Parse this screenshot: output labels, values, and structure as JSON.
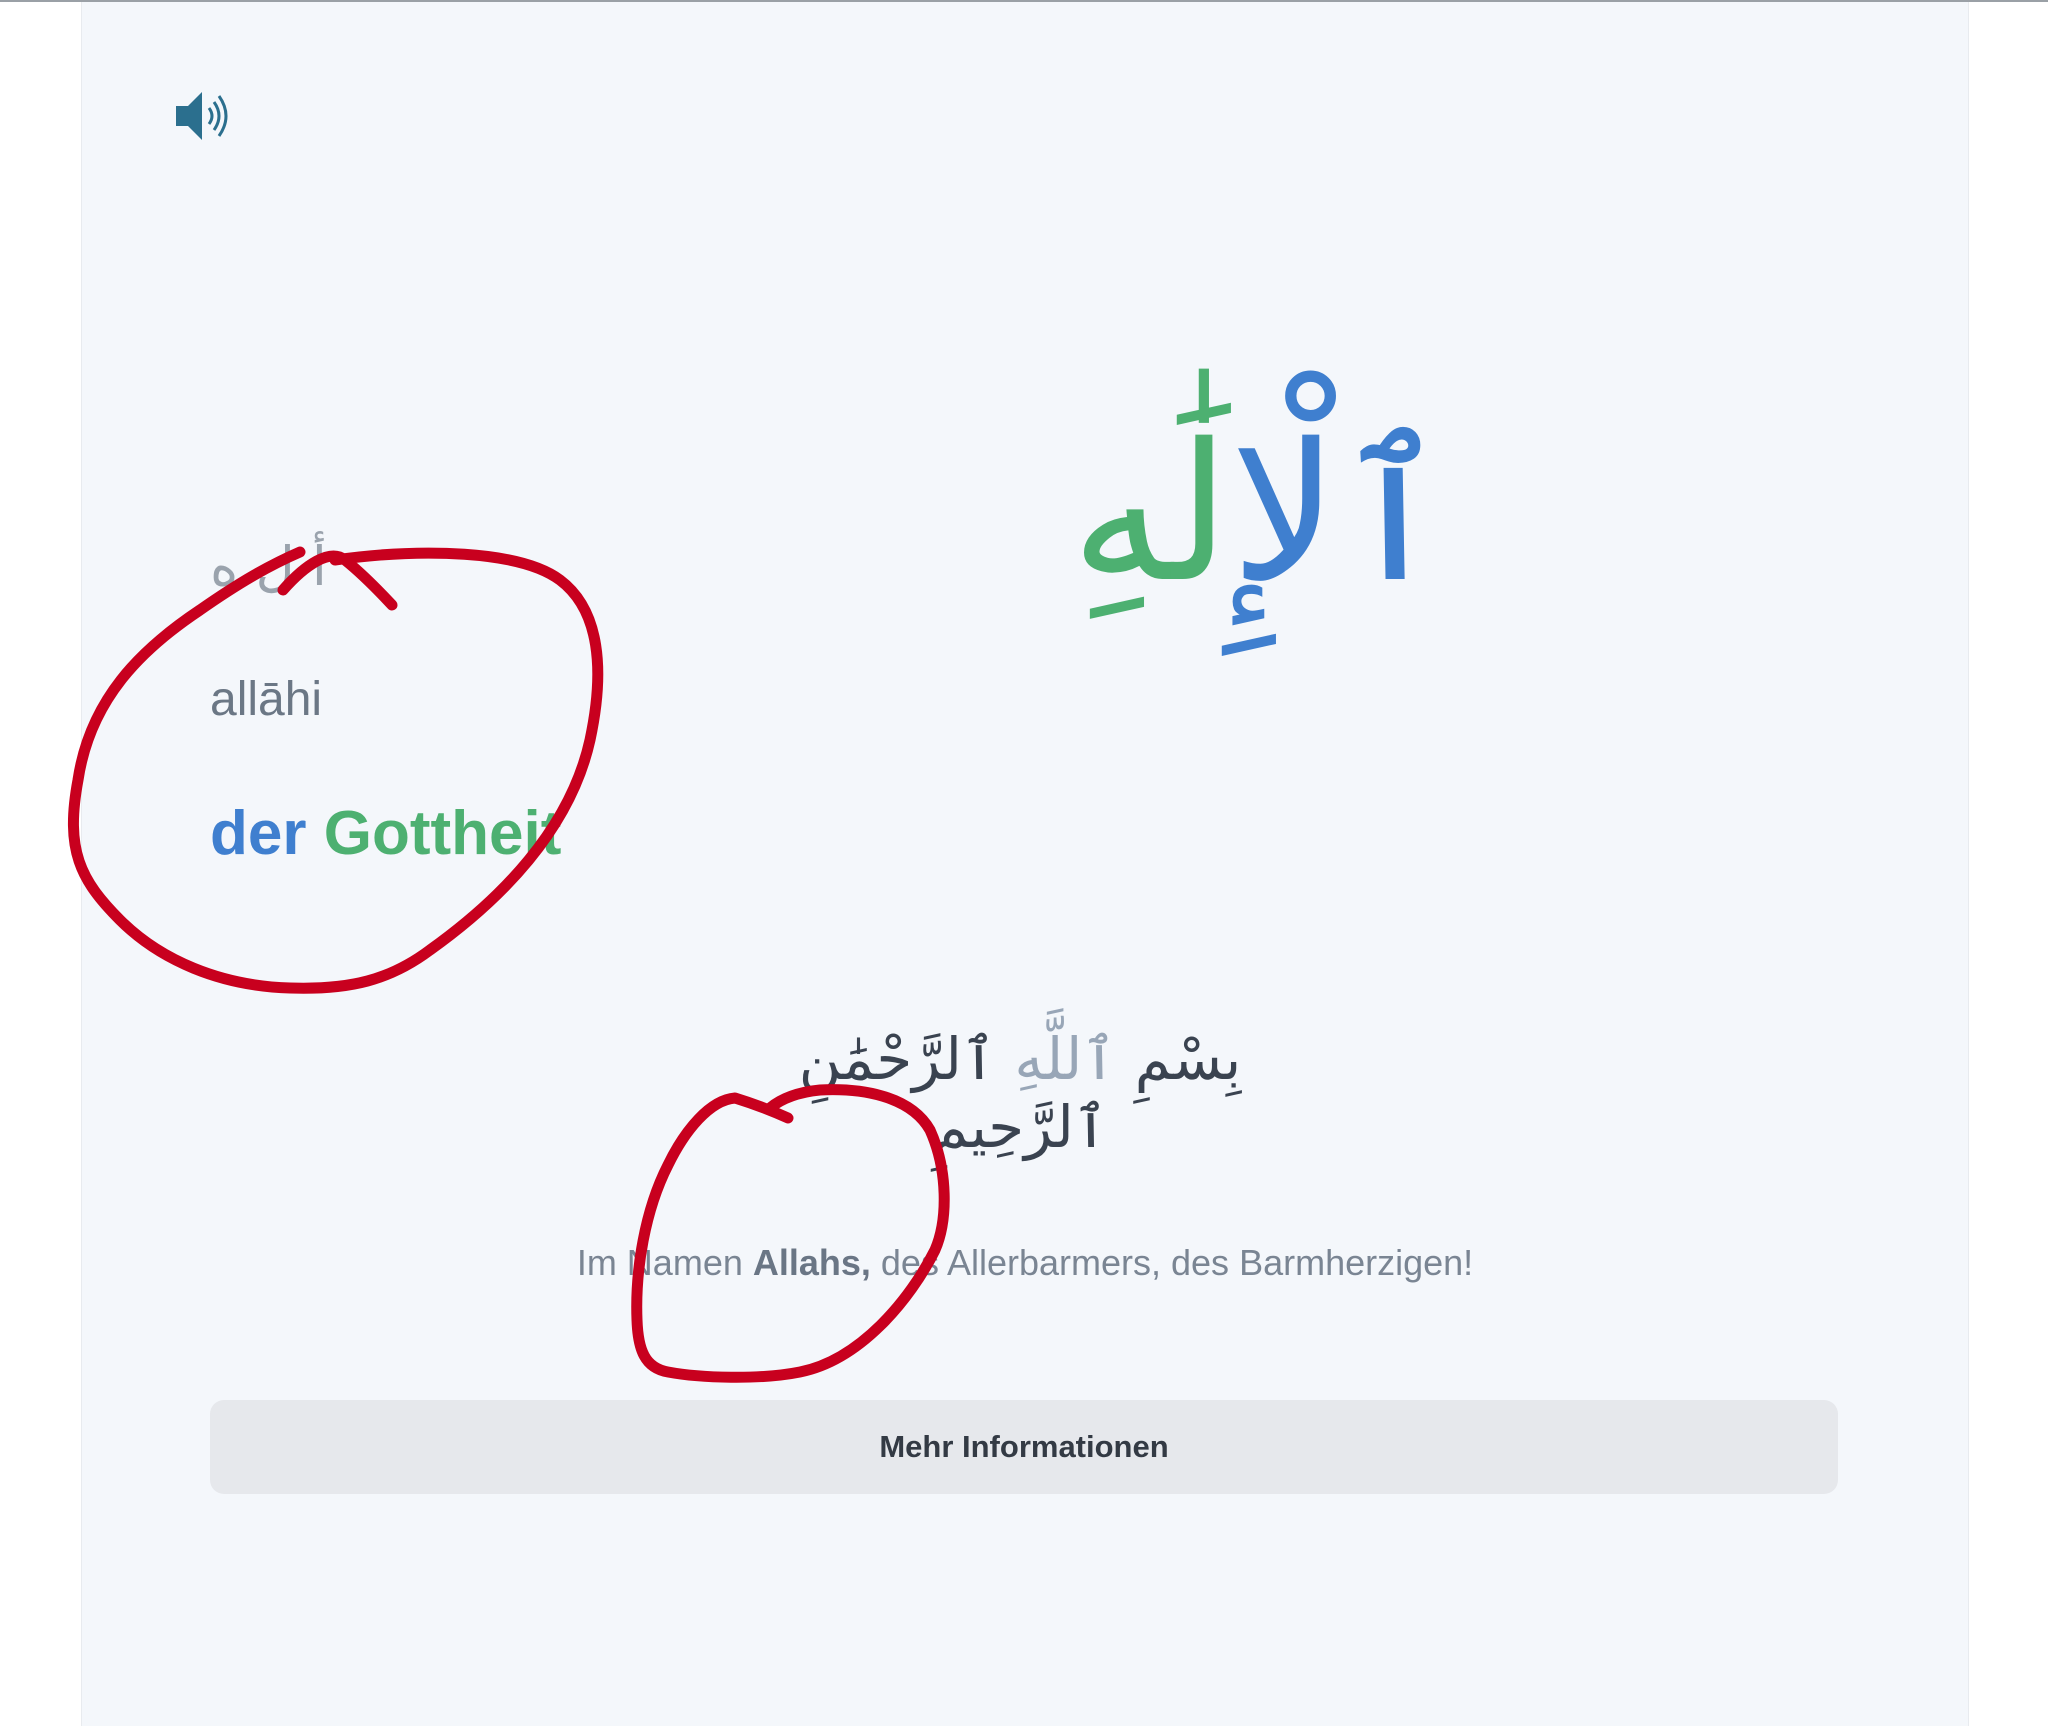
{
  "word": {
    "root_arabic": "أ ل ه",
    "transliteration": "allāhi",
    "german_part1": "der",
    "german_part2": "Gottheit",
    "arabic_part1": "ٱلْ",
    "arabic_part2": "إِلَٰهِ"
  },
  "verse": {
    "before": "بِسْمِ ",
    "highlight": "ٱللَّهِ",
    "after": " ٱلرَّحْمَٰنِ ٱلرَّحِيمِ",
    "translation_before": "Im Namen ",
    "translation_bold": "Allahs,",
    "translation_after": " des Allerbarmers, des Barmherzigen!"
  },
  "actions": {
    "more_button": "Mehr Informationen"
  },
  "icons": {
    "audio": "speaker-icon"
  },
  "colors": {
    "accent_blue": "#3f7fcf",
    "accent_green": "#4db071",
    "annotation_red": "#c8001e",
    "icon_teal": "#2b6f8e"
  }
}
